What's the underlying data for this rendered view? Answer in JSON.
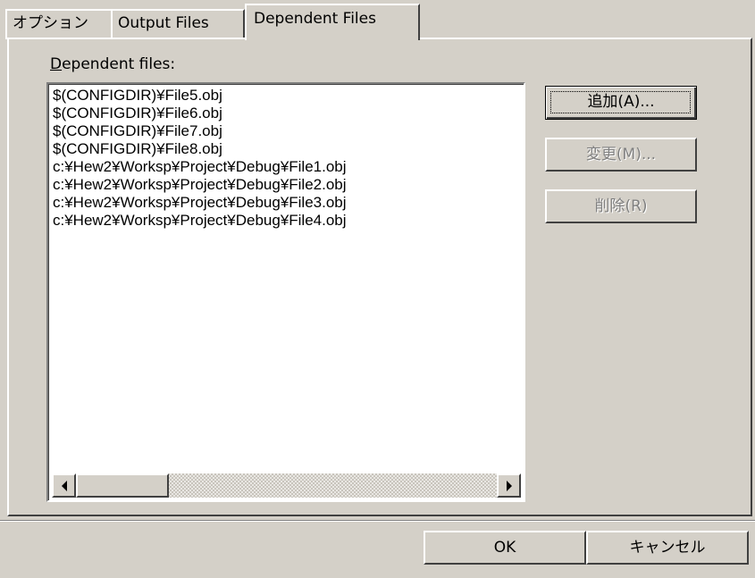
{
  "tabs": [
    {
      "label": "オプション"
    },
    {
      "label": "Output Files"
    },
    {
      "label": "Dependent Files"
    }
  ],
  "dependent_label_prefix": "D",
  "dependent_label_rest": "ependent files:",
  "files": [
    "$(CONFIGDIR)¥File5.obj",
    "$(CONFIGDIR)¥File6.obj",
    "$(CONFIGDIR)¥File7.obj",
    "$(CONFIGDIR)¥File8.obj",
    "c:¥Hew2¥Worksp¥Project¥Debug¥File1.obj",
    "c:¥Hew2¥Worksp¥Project¥Debug¥File2.obj",
    "c:¥Hew2¥Worksp¥Project¥Debug¥File3.obj",
    "c:¥Hew2¥Worksp¥Project¥Debug¥File4.obj"
  ],
  "buttons": {
    "add": "追加(A)...",
    "modify": "変更(M)...",
    "delete": "削除(R)",
    "ok": "OK",
    "cancel": "キャンセル"
  },
  "icons": {
    "scroll_left": "scroll-left-arrow-icon",
    "scroll_right": "scroll-right-arrow-icon"
  },
  "colors": {
    "face": "#d4d0c8",
    "highlight": "#ffffff",
    "shadow": "#808080",
    "dark_shadow": "#404040",
    "disabled_text": "#808080"
  }
}
